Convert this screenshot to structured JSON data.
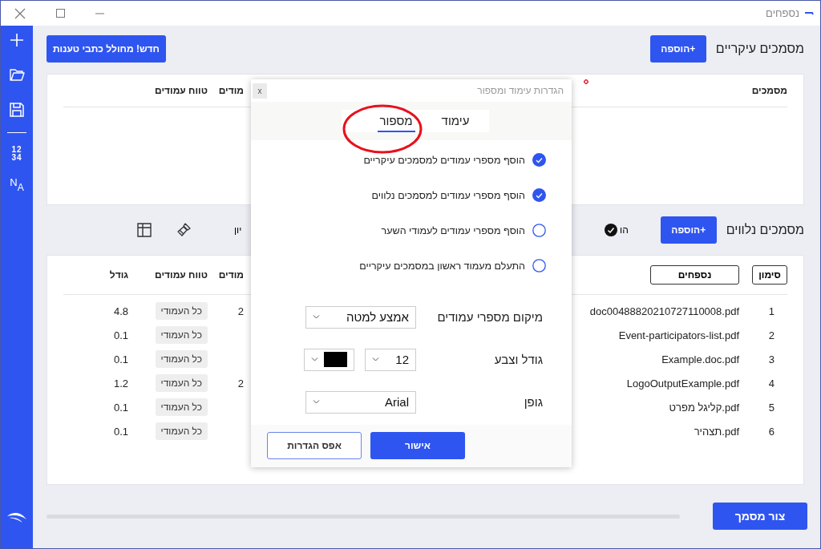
{
  "window": {
    "title": "נספחים"
  },
  "sidebar": {
    "numbering_glyph": [
      "12",
      "34"
    ],
    "direction_glyph": [
      "N",
      "A"
    ]
  },
  "main_documents": {
    "heading": "מסמכים עיקריים",
    "add_button": "הוספה+",
    "generator_button": "חדש! מחולל כתבי טענות",
    "table": {
      "columns": [
        "מסמכים",
        "מודים",
        "טווח עמודים"
      ]
    }
  },
  "attachments": {
    "heading": "מסמכים נלווים",
    "add_button": "הוספה+",
    "toolbar_fragments": [
      "הו",
      "יון"
    ],
    "table": {
      "columns": [
        "סימון",
        "נספחים",
        "מודים",
        "טווח עמודים",
        "גודל"
      ],
      "rows": [
        {
          "index": "1",
          "name": "doc00488820210727110008.pdf",
          "pages": "2",
          "range": "כל העמודי",
          "size": "4.8"
        },
        {
          "index": "2",
          "name": "Event-participators-list.pdf",
          "range": "כל העמודי",
          "size": "0.1"
        },
        {
          "index": "3",
          "name": "Example.doc.pdf",
          "range": "כל העמודי",
          "size": "0.1"
        },
        {
          "index": "4",
          "name": "LogoOutputExample.pdf",
          "pages": "2",
          "range": "כל העמודי",
          "size": "1.2"
        },
        {
          "index": "5",
          "name": "קליגל מפרט.pdf",
          "range": "כל העמודי",
          "size": "0.1"
        },
        {
          "index": "6",
          "name": "תצהיר.pdf",
          "range": "כל העמודי",
          "size": "0.1"
        }
      ]
    }
  },
  "create_button": "צור מסמך",
  "dialog": {
    "title": "הגדרות עימוד ומספור",
    "close": "x",
    "tabs": [
      {
        "label": "עימוד",
        "selected": false
      },
      {
        "label": "מספור",
        "selected": true
      }
    ],
    "options": [
      {
        "label": "הוסף מספרי עמודים למסמכים עיקריים",
        "checked": true
      },
      {
        "label": "הוסף מספרי עמודים למסמכים נלווים",
        "checked": true
      },
      {
        "label": "הוסף מספרי עמודים לעמודי השער",
        "checked": false
      },
      {
        "label": "התעלם מעמוד ראשון במסמכים עיקריים",
        "checked": false
      }
    ],
    "fields": [
      {
        "kind": "select",
        "label": "מיקום מספרי עמודים",
        "value": "אמצע למטה"
      },
      {
        "kind": "size_color",
        "label": "גודל וצבע",
        "value": "12",
        "color": "#000000"
      },
      {
        "kind": "select",
        "label": "גופן",
        "value": "Arial"
      }
    ],
    "buttons": [
      {
        "label": "אישור",
        "kind": "primary"
      },
      {
        "label": "אפס הגדרות",
        "kind": "secondary"
      }
    ]
  },
  "highlight_ellipse": true
}
